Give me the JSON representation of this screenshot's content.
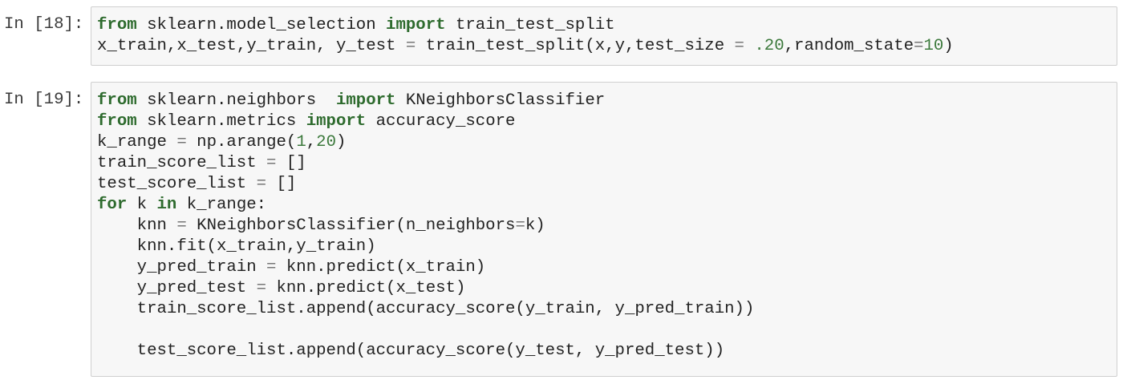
{
  "cells": [
    {
      "prompt": "In [18]:",
      "lines": [
        [
          [
            "kw",
            "from"
          ],
          [
            "t",
            " sklearn.model_selection "
          ],
          [
            "kw",
            "import"
          ],
          [
            "t",
            " train_test_split"
          ]
        ],
        [
          [
            "t",
            "x_train,x_test,y_train, y_test "
          ],
          [
            "op",
            "="
          ],
          [
            "t",
            " train_test_split(x,y,test_size "
          ],
          [
            "op",
            "="
          ],
          [
            "t",
            " "
          ],
          [
            "num",
            ".20"
          ],
          [
            "t",
            ",random_state"
          ],
          [
            "op",
            "="
          ],
          [
            "num",
            "10"
          ],
          [
            "t",
            ")"
          ]
        ]
      ]
    },
    {
      "prompt": "In [19]:",
      "lines": [
        [
          [
            "kw",
            "from"
          ],
          [
            "t",
            " sklearn.neighbors  "
          ],
          [
            "kw",
            "import"
          ],
          [
            "t",
            " KNeighborsClassifier"
          ]
        ],
        [
          [
            "kw",
            "from"
          ],
          [
            "t",
            " sklearn.metrics "
          ],
          [
            "kw",
            "import"
          ],
          [
            "t",
            " accuracy_score"
          ]
        ],
        [
          [
            "t",
            "k_range "
          ],
          [
            "op",
            "="
          ],
          [
            "t",
            " np.arange("
          ],
          [
            "num",
            "1"
          ],
          [
            "t",
            ","
          ],
          [
            "num",
            "20"
          ],
          [
            "t",
            ")"
          ]
        ],
        [
          [
            "t",
            "train_score_list "
          ],
          [
            "op",
            "="
          ],
          [
            "t",
            " []"
          ]
        ],
        [
          [
            "t",
            "test_score_list "
          ],
          [
            "op",
            "="
          ],
          [
            "t",
            " []"
          ]
        ],
        [
          [
            "kw",
            "for"
          ],
          [
            "t",
            " k "
          ],
          [
            "kw",
            "in"
          ],
          [
            "t",
            " k_range:"
          ]
        ],
        [
          [
            "t",
            "    knn "
          ],
          [
            "op",
            "="
          ],
          [
            "t",
            " KNeighborsClassifier(n_neighbors"
          ],
          [
            "op",
            "="
          ],
          [
            "t",
            "k)"
          ]
        ],
        [
          [
            "t",
            "    knn.fit(x_train,y_train)"
          ]
        ],
        [
          [
            "t",
            "    y_pred_train "
          ],
          [
            "op",
            "="
          ],
          [
            "t",
            " knn.predict(x_train)"
          ]
        ],
        [
          [
            "t",
            "    y_pred_test "
          ],
          [
            "op",
            "="
          ],
          [
            "t",
            " knn.predict(x_test)"
          ]
        ],
        [
          [
            "t",
            "    train_score_list.append(accuracy_score(y_train, y_pred_train))"
          ]
        ],
        [
          [
            "t",
            ""
          ]
        ],
        [
          [
            "t",
            "    test_score_list.append(accuracy_score(y_test, y_pred_test))"
          ]
        ]
      ]
    }
  ]
}
